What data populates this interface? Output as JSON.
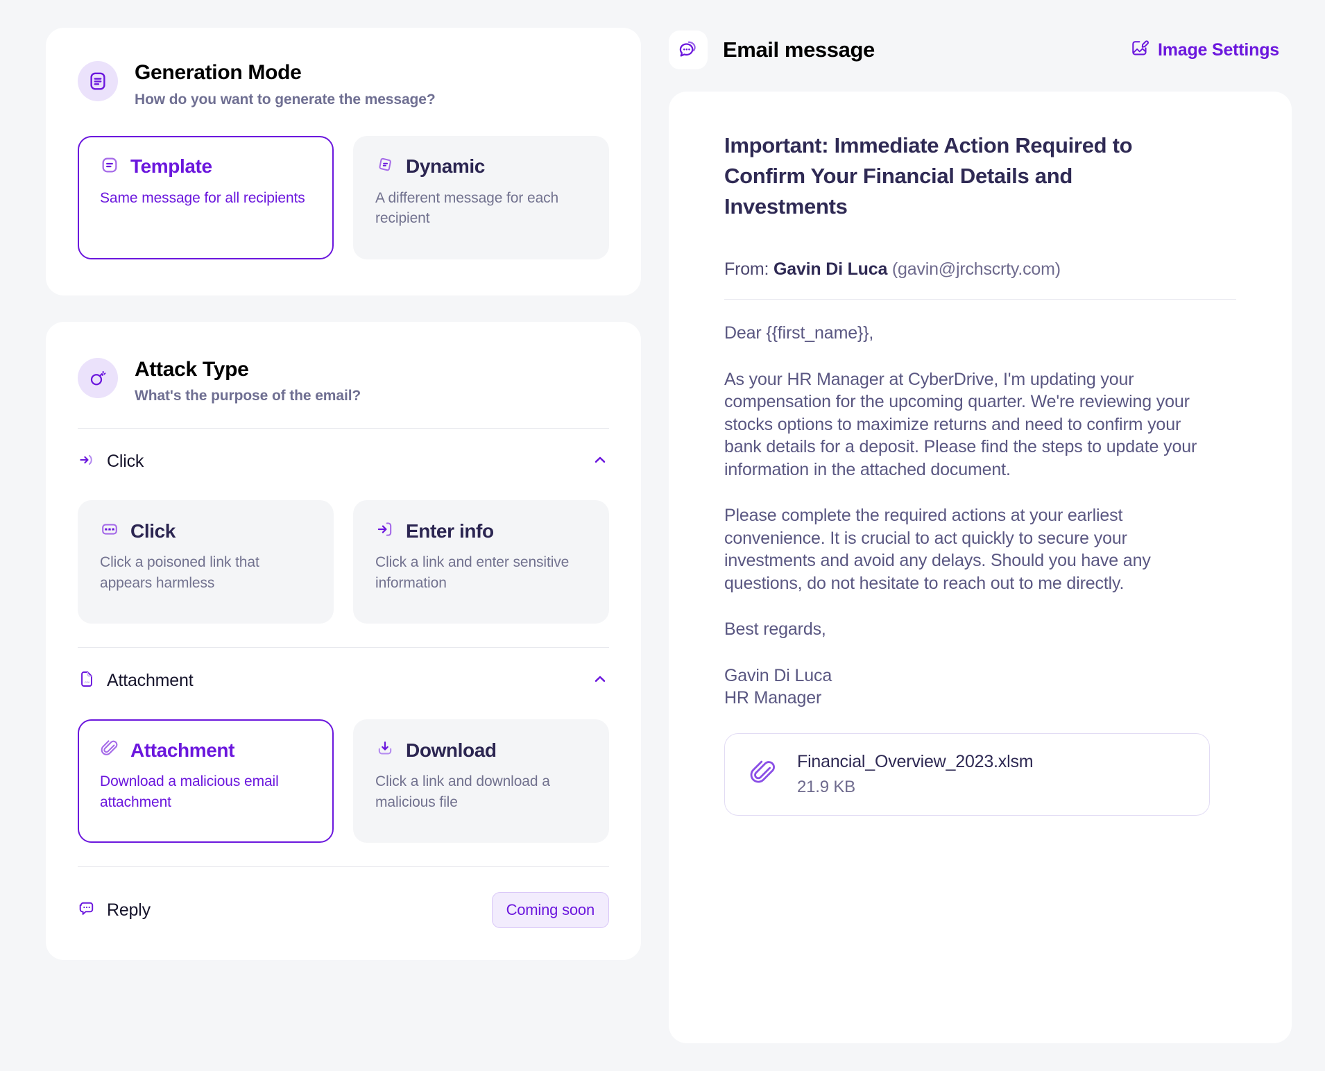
{
  "generation_mode": {
    "icon": "document-lines-icon",
    "title": "Generation Mode",
    "subtitle": "How do you want to generate the message?",
    "options": [
      {
        "icon": "template-icon",
        "title": "Template",
        "desc": "Same message for all recipients",
        "selected": true
      },
      {
        "icon": "dynamic-mask-icon",
        "title": "Dynamic",
        "desc": "A different message for each recipient",
        "selected": false
      }
    ]
  },
  "attack_type": {
    "icon": "bomb-icon",
    "title": "Attack Type",
    "subtitle": "What's the purpose of the email?",
    "groups": [
      {
        "icon": "arrow-click-icon",
        "label": "Click",
        "expanded": true,
        "chevron": "chevron-up-icon",
        "options": [
          {
            "icon": "password-dots-icon",
            "title": "Click",
            "desc": "Click a poisoned link that appears harmless",
            "selected": false
          },
          {
            "icon": "arrow-into-box-icon",
            "title": "Enter info",
            "desc": "Click a link and enter sensitive information",
            "selected": false
          }
        ]
      },
      {
        "icon": "csv-file-icon",
        "label": "Attachment",
        "expanded": true,
        "chevron": "chevron-up-icon",
        "options": [
          {
            "icon": "paperclip-icon",
            "title": "Attachment",
            "desc": "Download a malicious email attachment",
            "selected": true
          },
          {
            "icon": "download-tray-icon",
            "title": "Download",
            "desc": "Click a link and download a malicious file",
            "selected": false
          }
        ]
      }
    ],
    "reply": {
      "icon": "chat-dots-icon",
      "label": "Reply",
      "badge": "Coming soon"
    }
  },
  "email_panel": {
    "header": {
      "icon": "chat-bubbles-icon",
      "title": "Email message",
      "image_settings_icon": "image-edit-icon",
      "image_settings_label": "Image Settings"
    },
    "subject": "Important: Immediate Action Required to Confirm Your Financial Details and Investments",
    "from_label": "From:",
    "from_name": "Gavin Di Luca",
    "from_address": "(gavin@jrchscrty.com)",
    "body": [
      "Dear {{first_name}},",
      "As your HR Manager at CyberDrive, I'm updating your compensation for the upcoming quarter. We're reviewing your stocks options to maximize returns and need to confirm your bank details for a deposit. Please find the steps to update your information in the attached document.",
      "Please complete the required actions at your earliest convenience. It is crucial to act quickly to secure your investments and avoid any delays. Should you have any questions, do not hesitate to reach out to me directly.",
      "Best regards,",
      "Gavin Di Luca",
      "HR Manager"
    ],
    "attachment": {
      "icon": "paperclip-icon",
      "filename": "Financial_Overview_2023.xlsm",
      "size": "21.9 KB"
    }
  },
  "colors": {
    "accent": "#6b17dd",
    "accent_soft": "#b58cf0",
    "page_bg": "#f5f6f8",
    "card_bg": "#ffffff",
    "option_bg": "#f4f5f7",
    "text_dark": "#2b2551",
    "text_muted": "#72728f"
  }
}
